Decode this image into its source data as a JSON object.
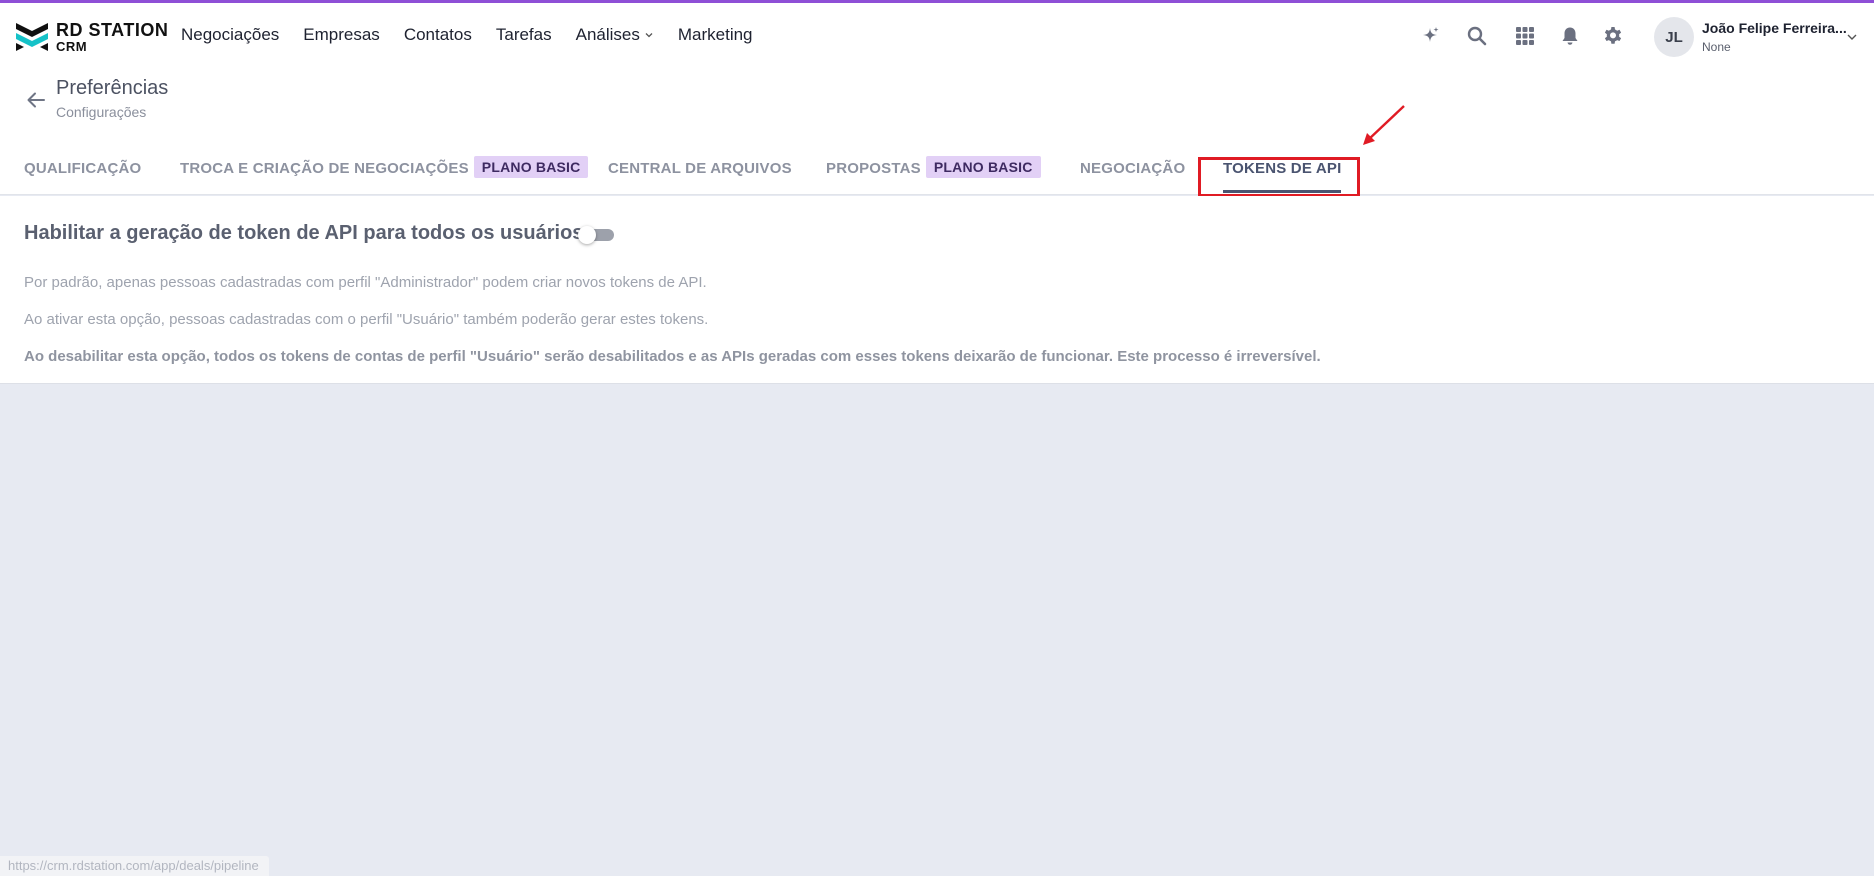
{
  "brand": {
    "name": "RD STATION",
    "product": "CRM",
    "accent_color": "#8e4fd6",
    "logo_colors": [
      "#15c2c8",
      "#101010"
    ]
  },
  "nav": {
    "items": [
      {
        "label": "Negociações"
      },
      {
        "label": "Empresas"
      },
      {
        "label": "Contatos"
      },
      {
        "label": "Tarefas"
      },
      {
        "label": "Análises",
        "has_dropdown": true
      },
      {
        "label": "Marketing"
      }
    ]
  },
  "top_icons": [
    "sparkle-icon",
    "search-icon",
    "apps-grid-icon",
    "bell-icon",
    "gear-icon"
  ],
  "user": {
    "initials": "JL",
    "name": "João Felipe Ferreira...",
    "subtitle": "None"
  },
  "page": {
    "title": "Preferências",
    "subtitle": "Configurações"
  },
  "tabs": [
    {
      "label": "QUALIFICAÇÃO",
      "badge": null,
      "active": false
    },
    {
      "label": "TROCA E CRIAÇÃO DE NEGOCIAÇÕES",
      "badge": "PLANO BASIC",
      "active": false
    },
    {
      "label": "CENTRAL DE ARQUIVOS",
      "badge": null,
      "active": false
    },
    {
      "label": "PROPOSTAS",
      "badge": "PLANO BASIC",
      "active": false
    },
    {
      "label": "NEGOCIAÇÃO",
      "badge": null,
      "active": false
    },
    {
      "label": "TOKENS DE API",
      "badge": null,
      "active": true
    }
  ],
  "settings": {
    "heading": "Habilitar a geração de token de API para todos os usuários",
    "toggle_on": false,
    "paragraphs": [
      "Por padrão, apenas pessoas cadastradas com perfil \"Administrador\" podem criar novos tokens de API.",
      "Ao ativar esta opção, pessoas cadastradas com o perfil \"Usuário\" também poderão gerar estes tokens.",
      "Ao desabilitar esta opção, todos os tokens de contas de perfil \"Usuário\" serão desabilitados e as APIs geradas com esses tokens deixarão de funcionar. Este processo é irreversível."
    ]
  },
  "annotation": {
    "highlight_color": "#e01b24",
    "target": "TOKENS DE API"
  },
  "status_bar": {
    "url": "https://crm.rdstation.com/app/deals/pipeline"
  }
}
